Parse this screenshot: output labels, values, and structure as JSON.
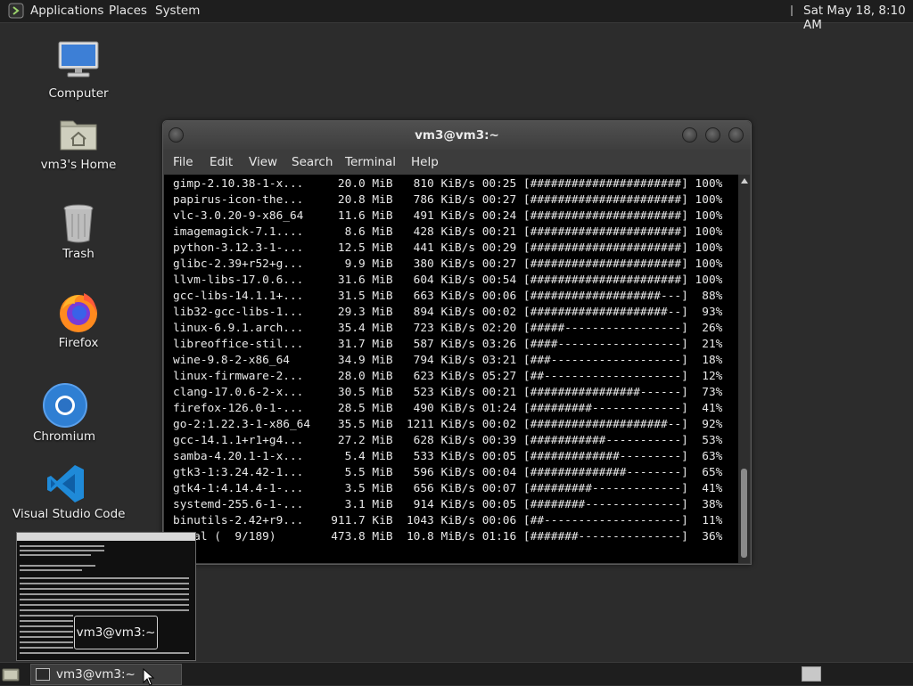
{
  "top_panel": {
    "menus": [
      "Applications",
      "Places",
      "System"
    ],
    "clock": "Sat May 18,  8:10 AM"
  },
  "desktop_icons": [
    {
      "label": "Computer",
      "icon": "computer-icon"
    },
    {
      "label": "vm3's Home",
      "icon": "home-folder-icon"
    },
    {
      "label": "Trash",
      "icon": "trash-icon"
    },
    {
      "label": "Firefox",
      "icon": "firefox-icon"
    },
    {
      "label": "Chromium",
      "icon": "chromium-icon"
    },
    {
      "label": "Visual Studio Code",
      "icon": "vscode-icon"
    }
  ],
  "terminal": {
    "title": "vm3@vm3:~",
    "menus": [
      "File",
      "Edit",
      "View",
      "Search",
      "Terminal",
      "Help"
    ],
    "lines": [
      "gimp-2.10.38-1-x...     20.0 MiB   810 KiB/s 00:25 [######################] 100%",
      "papirus-icon-the...     20.8 MiB   786 KiB/s 00:27 [######################] 100%",
      "vlc-3.0.20-9-x86_64     11.6 MiB   491 KiB/s 00:24 [######################] 100%",
      "imagemagick-7.1....      8.6 MiB   428 KiB/s 00:21 [######################] 100%",
      "python-3.12.3-1-...     12.5 MiB   441 KiB/s 00:29 [######################] 100%",
      "glibc-2.39+r52+g...      9.9 MiB   380 KiB/s 00:27 [######################] 100%",
      "llvm-libs-17.0.6...     31.6 MiB   604 KiB/s 00:54 [######################] 100%",
      "gcc-libs-14.1.1+...     31.5 MiB   663 KiB/s 00:06 [###################---]  88%",
      "lib32-gcc-libs-1...     29.3 MiB   894 KiB/s 00:02 [####################--]  93%",
      "linux-6.9.1.arch...     35.4 MiB   723 KiB/s 02:20 [#####-----------------]  26%",
      "libreoffice-stil...     31.7 MiB   587 KiB/s 03:26 [####------------------]  21%",
      "wine-9.8-2-x86_64       34.9 MiB   794 KiB/s 03:21 [###-------------------]  18%",
      "linux-firmware-2...     28.0 MiB   623 KiB/s 05:27 [##--------------------]  12%",
      "clang-17.0.6-2-x...     30.5 MiB   523 KiB/s 00:21 [################------]  73%",
      "firefox-126.0-1-...     28.5 MiB   490 KiB/s 01:24 [#########-------------]  41%",
      "go-2:1.22.3-1-x86_64    35.5 MiB  1211 KiB/s 00:02 [####################--]  92%",
      "gcc-14.1.1+r1+g4...     27.2 MiB   628 KiB/s 00:39 [###########-----------]  53%",
      "samba-4.20.1-1-x...      5.4 MiB   533 KiB/s 00:05 [#############---------]  63%",
      "gtk3-1:3.24.42-1...      5.5 MiB   596 KiB/s 00:04 [##############--------]  65%",
      "gtk4-1:4.14.4-1-...      3.5 MiB   656 KiB/s 00:07 [#########-------------]  41%",
      "systemd-255.6-1-...      3.1 MiB   914 KiB/s 00:05 [########--------------]  38%",
      "binutils-2.42+r9...    911.7 KiB  1043 KiB/s 00:06 [##--------------------]  11%",
      "Total (  9/189)        473.8 MiB  10.8 MiB/s 01:16 [#######---------------]  36%"
    ]
  },
  "preview": {
    "label": "vm3@vm3:~"
  },
  "taskbar": {
    "task_label": "vm3@vm3:~"
  },
  "colors": {
    "panel": "#1e1e1e",
    "desktop": "#2c2c2c",
    "terminal_bg": "#000000",
    "terminal_fg": "#e8e8e8"
  }
}
